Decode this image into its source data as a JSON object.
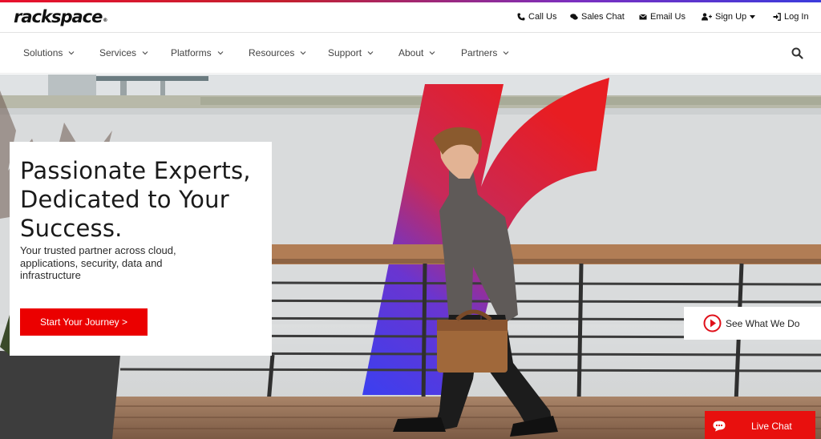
{
  "brand": {
    "logo_text": "rackspace",
    "logo_mark": "®",
    "accent": "#eb0000"
  },
  "utility_nav": [
    {
      "label": "Call Us",
      "icon": "phone-icon"
    },
    {
      "label": "Sales Chat",
      "icon": "chat-icon"
    },
    {
      "label": "Email Us",
      "icon": "envelope-icon"
    },
    {
      "label": "Sign Up",
      "icon": "user-plus-icon"
    },
    {
      "label": "Log In",
      "icon": "sign-in-icon"
    }
  ],
  "main_nav": [
    {
      "label": "Solutions"
    },
    {
      "label": "Services"
    },
    {
      "label": "Platforms"
    },
    {
      "label": "Resources"
    },
    {
      "label": "Support"
    },
    {
      "label": "About"
    },
    {
      "label": "Partners"
    }
  ],
  "hero": {
    "headline": "Passionate Experts, Dedicated to Your Success.",
    "subtext": "Your trusted partner across cloud, applications, security, data and infrastructure",
    "cta_label": "Start Your Journey >",
    "video_label": "See What We Do"
  },
  "live_chat": {
    "label": "Live Chat"
  }
}
